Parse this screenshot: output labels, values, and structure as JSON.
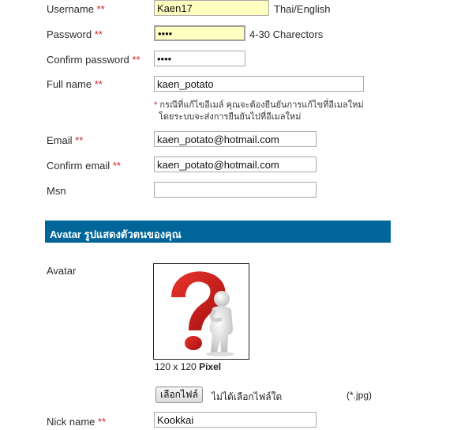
{
  "form": {
    "required_mark": "**",
    "username": {
      "label": "Username",
      "value": "Kaen17",
      "hint": "Thai/English"
    },
    "password": {
      "label": "Password",
      "value": "1234",
      "hint": "4-30 Charectors"
    },
    "confirm_password": {
      "label": "Confirm password",
      "value": "1234"
    },
    "full_name": {
      "label": "Full name",
      "value": "kaen_potato"
    },
    "email_note": {
      "star": "*",
      "line1": "กรณีที่แก้ไขอีเมล์ คุณจะต้องยืนยันการแก้ไขที่อีเมลใหม่",
      "line2": "โดยระบบจะส่งการยืนยันไปที่อีเมลใหม่"
    },
    "email": {
      "label": "Email",
      "value": "kaen_potato@hotmail.com"
    },
    "confirm_email": {
      "label": "Confirm email",
      "value": "kaen_potato@hotmail.com"
    },
    "msn": {
      "label": "Msn",
      "value": ""
    }
  },
  "avatar_section": {
    "title": "Avatar รูปแสดงตัวตนของคุณ",
    "label": "Avatar",
    "size_text": "120 x 120",
    "size_unit": "Pixel",
    "file_button": "เลือกไฟล์",
    "file_status": "ไม่ได้เลือกไฟล์ใด",
    "file_ext": "(*.jpg)",
    "image_icon": "question-mark-figure-icon"
  },
  "nickname": {
    "label": "Nick name",
    "value": "Kookkai"
  },
  "colors": {
    "header_bar": "#006699",
    "required": "#cc2222",
    "autofill": "#ffffc0"
  }
}
